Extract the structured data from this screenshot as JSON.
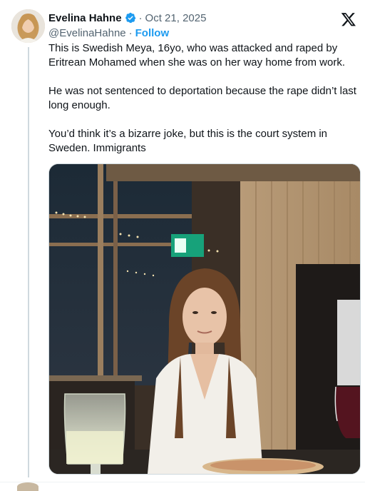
{
  "author": {
    "name": "Evelina Hahne",
    "handle": "@EvelinaHahne",
    "follow_label": "Follow",
    "separator": "·",
    "date": "Oct 21, 2025"
  },
  "tweet": {
    "paragraphs": [
      "This is Swedish Meya, 16yo, who was attacked and raped by Eritrean Mohamed when she was on her way home from work.",
      "He was not sentenced to deportation because the rape didn’t last long enough.",
      "You’d think it’s a bizarre joke, but this is the court system in Sweden. Immigrants"
    ]
  },
  "icons": {
    "verified": "verified-badge-icon",
    "platform": "x-logo-icon"
  },
  "colors": {
    "accent": "#1d9bf0",
    "text": "#0f1419",
    "secondary": "#536471",
    "border": "#cfd9de"
  }
}
